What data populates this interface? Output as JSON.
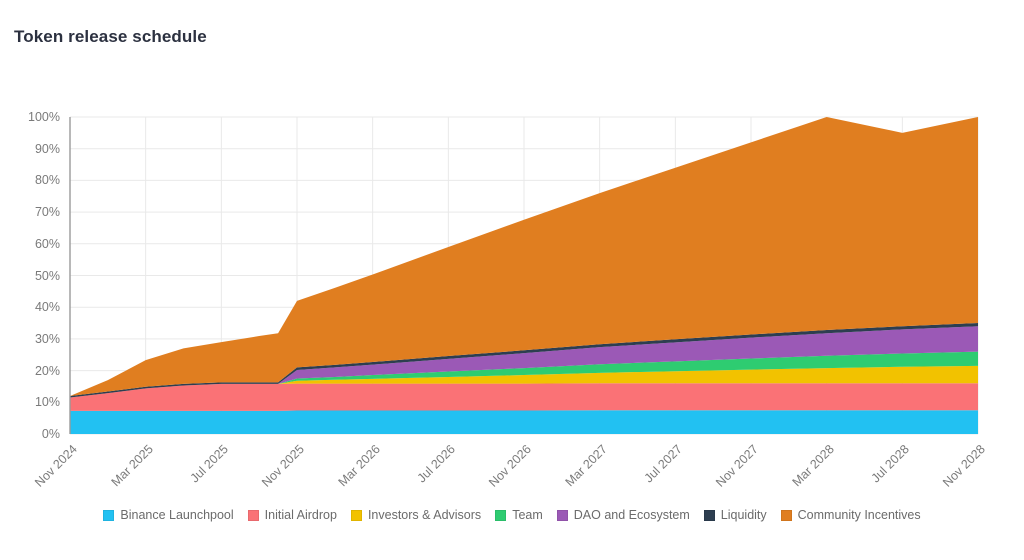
{
  "title": "Token release schedule",
  "chart_data": {
    "type": "area",
    "stacked": true,
    "stack_mode": "cumulative-percent",
    "title": "Token release schedule",
    "xlabel": "",
    "ylabel": "",
    "ylim": [
      0,
      100
    ],
    "y_tick_labels": [
      "0%",
      "10%",
      "20%",
      "30%",
      "40%",
      "50%",
      "60%",
      "70%",
      "80%",
      "90%",
      "100%"
    ],
    "y_ticks": [
      0,
      10,
      20,
      30,
      40,
      50,
      60,
      70,
      80,
      90,
      100
    ],
    "grid": true,
    "legend_position": "bottom",
    "categories": [
      "Nov 2024",
      "Mar 2025",
      "Jul 2025",
      "Nov 2025",
      "Mar 2026",
      "Jul 2026",
      "Nov 2026",
      "Mar 2027",
      "Jul 2027",
      "Nov 2027",
      "Mar 2028",
      "Jul 2028",
      "Nov 2028"
    ],
    "x": [
      "Nov 2024",
      "Jan 2025",
      "Mar 2025",
      "May 2025",
      "Jul 2025",
      "Sep 2025",
      "Oct 2025",
      "Nov 2025",
      "Jan 2026",
      "Mar 2026",
      "Jul 2026",
      "Nov 2026",
      "Mar 2027",
      "Jul 2027",
      "Nov 2027",
      "Mar 2028",
      "Jul 2028",
      "Nov 2028"
    ],
    "series": [
      {
        "name": "Binance Launchpool",
        "color": "#22c1f2",
        "values": [
          7.3,
          7.3,
          7.3,
          7.3,
          7.3,
          7.3,
          7.3,
          7.4,
          7.4,
          7.4,
          7.4,
          7.4,
          7.5,
          7.5,
          7.5,
          7.5,
          7.5,
          7.5
        ]
      },
      {
        "name": "Initial Airdrop",
        "color": "#fa7276",
        "values": [
          4.2,
          5.6,
          7.1,
          8.0,
          8.5,
          8.5,
          8.5,
          8.5,
          8.5,
          8.5,
          8.5,
          8.5,
          8.5,
          8.5,
          8.5,
          8.5,
          8.5,
          8.5
        ]
      },
      {
        "name": "Investors & Advisors",
        "color": "#f2c200",
        "values": [
          0,
          0,
          0,
          0,
          0,
          0,
          0,
          0.9,
          1.2,
          1.5,
          2.1,
          2.7,
          3.3,
          3.8,
          4.3,
          4.8,
          5.2,
          5.5
        ]
      },
      {
        "name": "Team",
        "color": "#2ecc71",
        "values": [
          0,
          0,
          0,
          0,
          0,
          0,
          0,
          0.7,
          0.9,
          1.2,
          1.7,
          2.2,
          2.7,
          3.1,
          3.5,
          3.9,
          4.2,
          4.5
        ]
      },
      {
        "name": "DAO and Ecosystem",
        "color": "#9b59b6",
        "values": [
          0,
          0,
          0,
          0,
          0,
          0,
          0,
          2.7,
          3.0,
          3.3,
          4.0,
          4.7,
          5.4,
          6.0,
          6.6,
          7.1,
          7.6,
          8.0
        ]
      },
      {
        "name": "Liquidity",
        "color": "#2d3e50",
        "values": [
          0.5,
          0.5,
          0.5,
          0.5,
          0.5,
          0.5,
          0.5,
          0.8,
          0.8,
          0.8,
          0.9,
          0.9,
          0.9,
          1.0,
          1.0,
          1.0,
          1.0,
          1.0
        ]
      },
      {
        "name": "Community Incentives",
        "color": "#e07e20",
        "values": [
          0,
          3.6,
          8.4,
          11.2,
          12.7,
          14.6,
          15.5,
          21.0,
          24.3,
          27.6,
          34.4,
          41.2,
          47.7,
          54.1,
          60.6,
          67.2,
          61.0,
          65.0
        ]
      }
    ],
    "stacked_totals": [
      12.0,
      17.0,
      23.3,
      27.0,
      29.0,
      30.9,
      31.8,
      42.0,
      46.1,
      50.3,
      59.0,
      67.6,
      76.0,
      84.0,
      92.0,
      100.0,
      95.0,
      100.0
    ],
    "cumulative_tops_final": {
      "Binance Launchpool": 7.5,
      "Initial Airdrop": 16.0,
      "Investors & Advisors": 21.5,
      "Team": 26.0,
      "DAO and Ecosystem": 34.0,
      "Liquidity": 35.0,
      "Community Incentives": 100.0
    }
  },
  "legend": [
    {
      "label": "Binance Launchpool",
      "color": "#22c1f2"
    },
    {
      "label": "Initial Airdrop",
      "color": "#fa7276"
    },
    {
      "label": "Investors & Advisors",
      "color": "#f2c200"
    },
    {
      "label": "Team",
      "color": "#2ecc71"
    },
    {
      "label": "DAO and Ecosystem",
      "color": "#9b59b6"
    },
    {
      "label": "Liquidity",
      "color": "#2d3e50"
    },
    {
      "label": "Community Incentives",
      "color": "#e07e20"
    }
  ]
}
